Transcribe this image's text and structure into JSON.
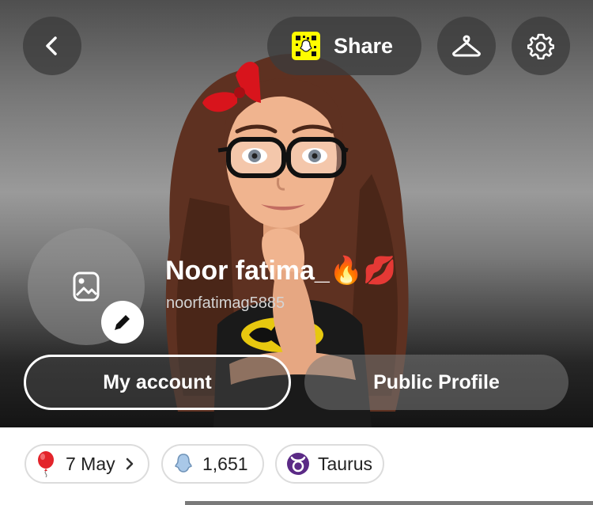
{
  "header": {
    "back_icon": "chevron-left-icon",
    "share_label": "Share",
    "snapcode_icon": "snapcode-icon",
    "wardrobe_icon": "hanger-icon",
    "settings_icon": "gear-icon"
  },
  "profile": {
    "display_name": "Noor fatima_🔥💋",
    "username": "noorfatimag5885",
    "photo_icon": "image-icon",
    "edit_icon": "pencil-icon"
  },
  "actions": {
    "my_account_label": "My account",
    "public_profile_label": "Public Profile"
  },
  "chips": [
    {
      "icon": "balloon-icon",
      "label": "7 May"
    },
    {
      "icon": "ghost-icon",
      "label": "1,651"
    },
    {
      "icon": "taurus-icon",
      "label": "Taurus"
    }
  ],
  "colors": {
    "snap_yellow": "#fffc00",
    "balloon_red": "#e3242b",
    "ghost_blue": "#a9c8e8",
    "taurus_purple": "#5b2a86"
  }
}
